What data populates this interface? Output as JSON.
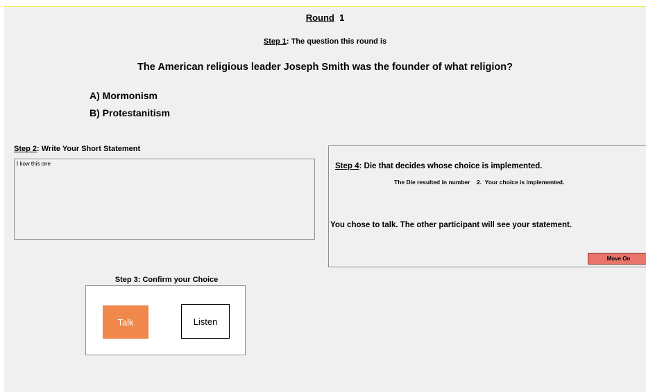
{
  "header": {
    "round_label": "Round",
    "round_number": "1"
  },
  "step1": {
    "label": "Step 1",
    "text": ":  The question this round is"
  },
  "question": {
    "text": "The American religious leader Joseph Smith was the founder of what religion?",
    "options": [
      {
        "label": "A) Mormonism"
      },
      {
        "label": "B) Protestanitism"
      }
    ]
  },
  "step2": {
    "label": "Step 2",
    "text": ": Write Your Short Statement",
    "statement_value": "I kow this one"
  },
  "step3": {
    "title": "Step 3: Confirm your Choice",
    "talk_label": "Talk",
    "listen_label": "Listen",
    "talk_color": "#f0874b"
  },
  "step4": {
    "label": "Step 4",
    "text": ": Die that decides whose choice is implemented.",
    "die_result": "The Die resulted in number    2.  Your choice is implemented.",
    "talk_message": "You chose to talk. The other participant will see your statement.",
    "move_on_label": "Move On",
    "move_on_color": "#e8746b"
  }
}
